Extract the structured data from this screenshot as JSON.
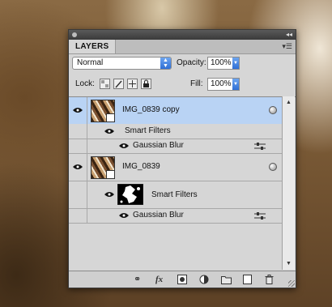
{
  "panel": {
    "tab_label": "LAYERS",
    "collapse_glyph": "◂◂",
    "menu_glyph": "▾☰"
  },
  "controls": {
    "blend_mode": "Normal",
    "opacity_label": "Opacity:",
    "opacity_value": "100%",
    "lock_label": "Lock:",
    "fill_label": "Fill:",
    "fill_value": "100%"
  },
  "layers": [
    {
      "name": "IMG_0839 copy",
      "selected": true,
      "smart_filters_label": "Smart Filters",
      "filter_name": "Gaussian Blur"
    },
    {
      "name": "IMG_0839",
      "selected": false,
      "smart_filters_label": "Smart Filters",
      "filter_name": "Gaussian Blur"
    }
  ],
  "footer": {
    "icons": [
      "link-icon",
      "fx-icon",
      "mask-icon",
      "adjustment-icon",
      "folder-icon",
      "new-layer-icon",
      "trash-icon"
    ],
    "fx_label": "fx"
  },
  "colors": {
    "selection": "#b9d3f4",
    "accent": "#2f6fd6",
    "panel_bg": "#d6d6d6"
  }
}
